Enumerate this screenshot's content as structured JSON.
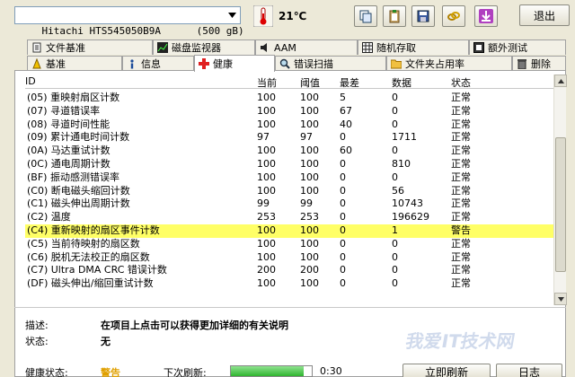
{
  "toolbar": {
    "drive": "Hitachi HTS545050B9A      (500 gB)",
    "temperature": "21℃",
    "icons": [
      "copy-icon",
      "clipboard-icon",
      "save-icon",
      "link-icon",
      "download-icon"
    ],
    "exit_label": "退出"
  },
  "tabs_row1": [
    {
      "label": "文件基准",
      "icon": "file-icon"
    },
    {
      "label": "磁盘监视器",
      "icon": "chart-icon"
    },
    {
      "label": "AAM",
      "icon": "speaker-icon"
    },
    {
      "label": "随机存取",
      "icon": "grid-icon"
    },
    {
      "label": "额外测试",
      "icon": "extra-icon"
    }
  ],
  "tabs_row2": [
    {
      "label": "基准",
      "icon": "benchmark-icon"
    },
    {
      "label": "信息",
      "icon": "info-icon"
    },
    {
      "label": "健康",
      "icon": "health-cross-icon",
      "active": true
    },
    {
      "label": "错误扫描",
      "icon": "magnifier-icon"
    },
    {
      "label": "文件夹占用率",
      "icon": "folder-icon"
    },
    {
      "label": "删除",
      "icon": "trash-icon"
    }
  ],
  "table": {
    "headers": [
      "ID",
      "当前",
      "阈值",
      "最差",
      "数据",
      "状态"
    ],
    "rows": [
      [
        "(05) 重映射扇区计数",
        "100",
        "100",
        "5",
        "0",
        "正常"
      ],
      [
        "(07) 寻道错误率",
        "100",
        "100",
        "67",
        "0",
        "正常"
      ],
      [
        "(08) 寻道时间性能",
        "100",
        "100",
        "40",
        "0",
        "正常"
      ],
      [
        "(09) 累计通电时间计数",
        "97",
        "97",
        "0",
        "1711",
        "正常"
      ],
      [
        "(0A) 马达重试计数",
        "100",
        "100",
        "60",
        "0",
        "正常"
      ],
      [
        "(0C) 通电周期计数",
        "100",
        "100",
        "0",
        "810",
        "正常"
      ],
      [
        "(BF) 振动感测错误率",
        "100",
        "100",
        "0",
        "0",
        "正常"
      ],
      [
        "(C0) 断电磁头缩回计数",
        "100",
        "100",
        "0",
        "56",
        "正常"
      ],
      [
        "(C1) 磁头伸出周期计数",
        "99",
        "99",
        "0",
        "10743",
        "正常"
      ],
      [
        "(C2) 温度",
        "253",
        "253",
        "0",
        "196629",
        "正常"
      ],
      [
        "(C4) 重新映射的扇区事件计数",
        "100",
        "100",
        "0",
        "1",
        "警告"
      ],
      [
        "(C5) 当前待映射的扇区数",
        "100",
        "100",
        "0",
        "0",
        "正常"
      ],
      [
        "(C6) 脱机无法校正的扇区数",
        "100",
        "100",
        "0",
        "0",
        "正常"
      ],
      [
        "(C7) Ultra DMA CRC 错误计数",
        "200",
        "200",
        "0",
        "0",
        "正常"
      ],
      [
        "(DF) 磁头伸出/缩回重试计数",
        "100",
        "100",
        "0",
        "0",
        "正常"
      ]
    ],
    "warning_row_index": 10,
    "warning_color": "#ffff66"
  },
  "description": {
    "label": "描述:",
    "value": "在项目上点击可以获得更加详细的有关说明",
    "state_label": "状态:",
    "state_value": "无"
  },
  "statusbar": {
    "health_label": "健康状态:",
    "health_value": "警告",
    "health_color": "#e0a000",
    "refresh_label": "下次刷新:",
    "refresh_progress": 0.9,
    "refresh_time": "0:30",
    "refresh_button": "立即刷新",
    "log_button": "日志"
  },
  "watermark": "我爱IT技术网"
}
